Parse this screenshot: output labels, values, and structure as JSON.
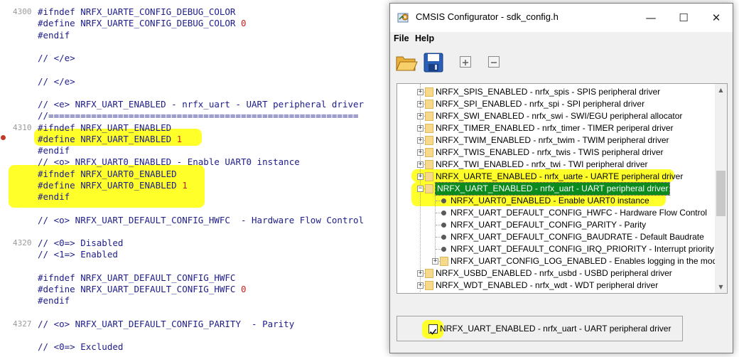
{
  "editor": {
    "lines": [
      {
        "no": "4300",
        "code": "#ifndef NRFX_UARTE_CONFIG_DEBUG_COLOR"
      },
      {
        "no": "",
        "code": "#define NRFX_UARTE_CONFIG_DEBUG_COLOR ",
        "num": "0"
      },
      {
        "no": "",
        "code": "#endif"
      },
      {
        "no": "",
        "code": ""
      },
      {
        "no": "",
        "code": "// </e>"
      },
      {
        "no": "",
        "code": ""
      },
      {
        "no": "",
        "code": "// </e>"
      },
      {
        "no": "",
        "code": ""
      },
      {
        "no": "",
        "code": "// <e> NRFX_UART_ENABLED - nrfx_uart - UART peripheral driver"
      },
      {
        "no": "",
        "code": "//=========================================================="
      },
      {
        "no": "4310",
        "code": "#ifndef NRFX_UART_ENABLED"
      },
      {
        "no": "",
        "code": "#define NRFX_UART_ENABLED ",
        "num": "1"
      },
      {
        "no": "",
        "code": "#endif"
      },
      {
        "no": "",
        "code": "// <o> NRFX_UART0_ENABLED - Enable UART0 instance"
      },
      {
        "no": "",
        "code": "#ifndef NRFX_UART0_ENABLED"
      },
      {
        "no": "",
        "code": "#define NRFX_UART0_ENABLED ",
        "num": "1"
      },
      {
        "no": "",
        "code": "#endif"
      },
      {
        "no": "",
        "code": ""
      },
      {
        "no": "",
        "code": "// <o> NRFX_UART_DEFAULT_CONFIG_HWFC  - Hardware Flow Control"
      },
      {
        "no": "",
        "code": ""
      },
      {
        "no": "4320",
        "code": "// <0=> Disabled"
      },
      {
        "no": "",
        "code": "// <1=> Enabled"
      },
      {
        "no": "",
        "code": ""
      },
      {
        "no": "",
        "code": "#ifndef NRFX_UART_DEFAULT_CONFIG_HWFC"
      },
      {
        "no": "",
        "code": "#define NRFX_UART_DEFAULT_CONFIG_HWFC ",
        "num": "0"
      },
      {
        "no": "",
        "code": "#endif"
      },
      {
        "no": "",
        "code": ""
      },
      {
        "no": "4327",
        "code": "// <o> NRFX_UART_DEFAULT_CONFIG_PARITY  - Parity"
      },
      {
        "no": "",
        "code": ""
      },
      {
        "no": "",
        "code": "// <0=> Excluded"
      }
    ]
  },
  "dialog": {
    "title": "CMSIS Configurator - sdk_config.h",
    "menu": {
      "file": "File",
      "help": "Help"
    },
    "window_buttons": {
      "minimize": "—",
      "maximize": "☐",
      "close": "✕"
    },
    "tree_items": [
      {
        "label": "NRFX_SPIS_ENABLED - nrfx_spis - SPIS peripheral driver",
        "kind": "folder",
        "expander": "+"
      },
      {
        "label": "NRFX_SPI_ENABLED - nrfx_spi - SPI peripheral driver",
        "kind": "folder",
        "expander": "+"
      },
      {
        "label": "NRFX_SWI_ENABLED - nrfx_swi - SWI/EGU peripheral allocator",
        "kind": "folder",
        "expander": "+"
      },
      {
        "label": "NRFX_TIMER_ENABLED - nrfx_timer - TIMER periperal driver",
        "kind": "folder",
        "expander": "+"
      },
      {
        "label": "NRFX_TWIM_ENABLED - nrfx_twim - TWIM peripheral driver",
        "kind": "folder",
        "expander": "+"
      },
      {
        "label": "NRFX_TWIS_ENABLED - nrfx_twis - TWIS peripheral driver",
        "kind": "folder",
        "expander": "+"
      },
      {
        "label": "NRFX_TWI_ENABLED - nrfx_twi - TWI peripheral driver",
        "kind": "folder",
        "expander": "+"
      },
      {
        "label": "NRFX_UARTE_ENABLED - nrfx_uarte - UARTE peripheral driver",
        "kind": "folder",
        "expander": "+"
      },
      {
        "label": "NRFX_UART_ENABLED - nrfx_uart - UART peripheral driver",
        "kind": "folder",
        "expander": "−",
        "selected": true
      },
      {
        "label": "NRFX_UART0_ENABLED - Enable UART0 instance",
        "kind": "leaf"
      },
      {
        "label": "NRFX_UART_DEFAULT_CONFIG_HWFC  - Hardware Flow Control",
        "kind": "leaf"
      },
      {
        "label": "NRFX_UART_DEFAULT_CONFIG_PARITY  - Parity",
        "kind": "leaf"
      },
      {
        "label": "NRFX_UART_DEFAULT_CONFIG_BAUDRATE  - Default Baudrate",
        "kind": "leaf"
      },
      {
        "label": "NRFX_UART_DEFAULT_CONFIG_IRQ_PRIORITY  - Interrupt priority",
        "kind": "leaf"
      },
      {
        "label": "NRFX_UART_CONFIG_LOG_ENABLED - Enables logging in the module",
        "kind": "subfolder",
        "expander": "+"
      },
      {
        "label": "NRFX_USBD_ENABLED - nrfx_usbd - USBD peripheral driver",
        "kind": "folder",
        "expander": "+"
      },
      {
        "label": "NRFX_WDT_ENABLED - nrfx_wdt - WDT peripheral driver",
        "kind": "folder",
        "expander": "+"
      }
    ],
    "status": {
      "label": "NRFX_UART_ENABLED - nrfx_uart - UART peripheral driver",
      "checked": true
    }
  },
  "colors": {
    "highlight": "#ffff2a",
    "selection": "#0b8a1e",
    "number": "#c81e1e",
    "code": "#1d1d8a"
  }
}
